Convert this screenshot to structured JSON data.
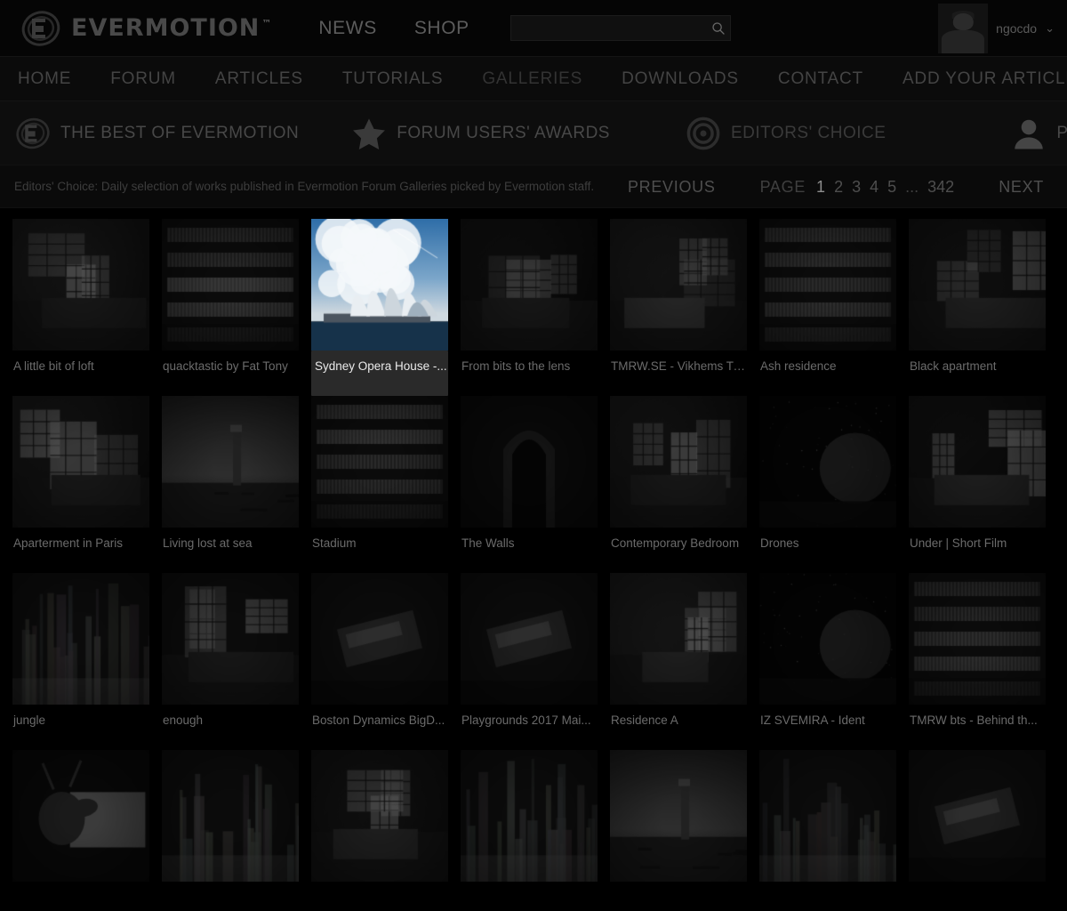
{
  "header": {
    "brand": "EVERMOTION",
    "brand_tm": "™",
    "brand_icon": "evermotion-e-logo-icon",
    "top_links": [
      {
        "label": "NEWS"
      },
      {
        "label": "SHOP"
      }
    ],
    "search": {
      "value": "",
      "placeholder": "",
      "icon": "search-icon"
    },
    "user": {
      "name": "ngocdo",
      "chevron": "⌄",
      "avatar_icon": "user-avatar-photo"
    }
  },
  "main_nav": [
    {
      "label": "HOME",
      "active": false
    },
    {
      "label": "FORUM",
      "active": false
    },
    {
      "label": "ARTICLES",
      "active": false
    },
    {
      "label": "TUTORIALS",
      "active": false
    },
    {
      "label": "GALLERIES",
      "active": true
    },
    {
      "label": "DOWNLOADS",
      "active": false
    },
    {
      "label": "CONTACT",
      "active": false
    },
    {
      "label": "ADD YOUR ARTICLE",
      "active": false
    }
  ],
  "sub_nav": [
    {
      "label": "THE BEST OF EVERMOTION",
      "icon": "evermotion-e-logo-icon"
    },
    {
      "label": "FORUM USERS' AWARDS",
      "icon": "star-icon"
    },
    {
      "label": "EDITORS' CHOICE",
      "icon": "target-bullseye-icon"
    },
    {
      "label": "PORTFOLIOS",
      "icon": "person-icon"
    }
  ],
  "pager": {
    "description": "Editors' Choice: Daily selection of works published in Evermotion Forum Galleries picked by Evermotion staff.",
    "previous_label": "PREVIOUS",
    "page_label": "PAGE",
    "pages": [
      "1",
      "2",
      "3",
      "4",
      "5"
    ],
    "ellipsis": "...",
    "last_page": "342",
    "next_label": "NEXT",
    "current_page": "1"
  },
  "gallery": {
    "items": [
      {
        "title": "A little bit of loft",
        "scene": "loft-interior",
        "highlight": false
      },
      {
        "title": "quacktastic by Fat Tony",
        "scene": "facade-louvers",
        "highlight": false
      },
      {
        "title": "Sydney Opera House -...",
        "scene": "sydney-opera",
        "highlight": true
      },
      {
        "title": "From bits to the lens",
        "scene": "fisheye-room",
        "highlight": false
      },
      {
        "title": "TMRW.SE - Vikhems Tr...",
        "scene": "dark-living",
        "highlight": false
      },
      {
        "title": "Ash residence",
        "scene": "balcony-building",
        "highlight": false
      },
      {
        "title": "Black apartment",
        "scene": "dark-apartment",
        "highlight": false
      },
      {
        "title": "Aparterment in Paris",
        "scene": "paris-bedroom",
        "highlight": false
      },
      {
        "title": "Living lost at sea",
        "scene": "lighthouse-sea",
        "highlight": false
      },
      {
        "title": "Stadium",
        "scene": "stadium-aerial",
        "highlight": false
      },
      {
        "title": "The Walls",
        "scene": "gothic-door",
        "highlight": false
      },
      {
        "title": "Contemporary Bedroom",
        "scene": "bedroom-white",
        "highlight": false
      },
      {
        "title": "Drones",
        "scene": "drones-night",
        "highlight": false
      },
      {
        "title": "Under | Short Film",
        "scene": "under-interior",
        "highlight": false
      },
      {
        "title": "jungle",
        "scene": "jungle-trees",
        "highlight": false
      },
      {
        "title": "enough",
        "scene": "pebble-room",
        "highlight": false
      },
      {
        "title": "Boston Dynamics BigD...",
        "scene": "bigdog-robot",
        "highlight": false
      },
      {
        "title": "Playgrounds 2017 Mai...",
        "scene": "machine-closeup",
        "highlight": false
      },
      {
        "title": "Residence A",
        "scene": "residence-a-house",
        "highlight": false
      },
      {
        "title": "IZ SVEMIRA - Ident",
        "scene": "space-planet",
        "highlight": false
      },
      {
        "title": "TMRW bts - Behind th...",
        "scene": "city-tower-river",
        "highlight": false
      },
      {
        "title": "",
        "scene": "deer-window",
        "highlight": false
      },
      {
        "title": "",
        "scene": "forest-waterfall",
        "highlight": false
      },
      {
        "title": "",
        "scene": "retro-living",
        "highlight": false
      },
      {
        "title": "",
        "scene": "village-field",
        "highlight": false
      },
      {
        "title": "",
        "scene": "parachute-beach",
        "highlight": false
      },
      {
        "title": "",
        "scene": "cabin-woods",
        "highlight": false
      },
      {
        "title": "",
        "scene": "classic-car",
        "highlight": false
      }
    ]
  },
  "colors": {
    "background": "#000000",
    "topbar": "#050505",
    "nav": "#0b0b0b",
    "subnav": "#0d0d0d",
    "text_dim": "#444444",
    "text_caption": "#6b6b6b",
    "highlight_bg": "#2a2a2a",
    "highlight_text": "#eaeaea"
  }
}
